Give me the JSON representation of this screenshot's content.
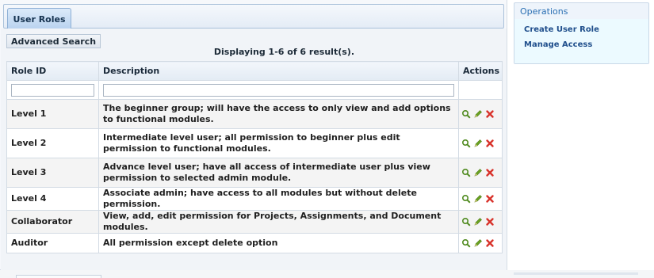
{
  "tab": {
    "label": "User Roles"
  },
  "toolbar": {
    "advanced_search_label": "Advanced Search"
  },
  "summary": {
    "text": "Displaying 1-6 of 6 result(s)."
  },
  "table": {
    "headers": {
      "role_id": "Role ID",
      "description": "Description",
      "actions": "Actions"
    },
    "rows": [
      {
        "role_id": "Level 1",
        "description": "The beginner group; will have the access to only view and add options to functional modules."
      },
      {
        "role_id": "Level 2",
        "description": "Intermediate level user; all permission to beginner plus edit permission to functional modules."
      },
      {
        "role_id": "Level 3",
        "description": "Advance level user; have all access of intermediate user plus view permission to selected admin module."
      },
      {
        "role_id": "Level 4",
        "description": "Associate admin; have access to all modules but without delete permission."
      },
      {
        "role_id": "Collaborator",
        "description": "View, add, edit permission for Projects, Assignments, and Document modules."
      },
      {
        "role_id": "Auditor",
        "description": "All permission except delete option"
      }
    ],
    "action_icons": [
      "view-icon",
      "edit-icon",
      "delete-icon"
    ]
  },
  "sidebar": {
    "title": "Operations",
    "links": [
      "Create User Role",
      "Manage Access"
    ]
  },
  "colors": {
    "link": "#204f8c",
    "sidebar_title": "#2a6fb3",
    "delete": "#d8322a",
    "edit": "#6aa322",
    "view": "#4f8a1e"
  }
}
